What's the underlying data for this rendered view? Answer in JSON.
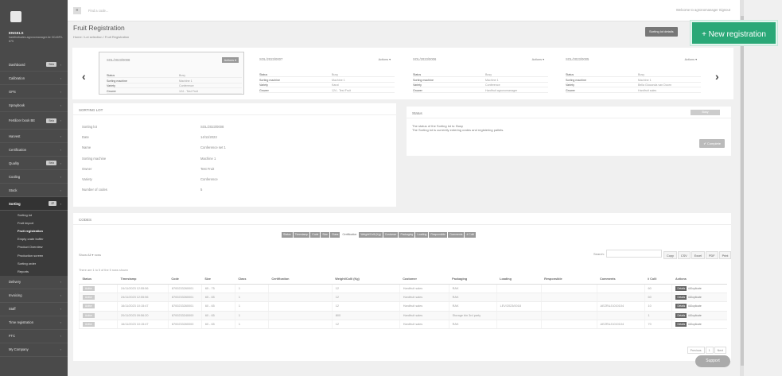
{
  "user": {
    "name": "ENGELS",
    "info": "hardfruitsales.agronomanager.be 0CA5F0-875"
  },
  "topbar": {
    "menu_icon": "hamburger-icon",
    "find": "Find a code...",
    "welcome": "Welcome to agronomanager  Signout"
  },
  "sidebar": {
    "items": [
      {
        "label": "Dashboard",
        "badge": "Beta"
      },
      {
        "label": "Calibration"
      },
      {
        "label": "GPS"
      },
      {
        "label": "Spraybook"
      },
      {
        "label": "Fertilizer book BE",
        "badge": "Beta"
      },
      {
        "label": "Harvest"
      },
      {
        "label": "Certification"
      },
      {
        "label": "Quality",
        "badge": "Beta"
      },
      {
        "label": "Cooling"
      },
      {
        "label": "Stock"
      },
      {
        "label": "Sorting",
        "badge": "27"
      },
      {
        "label": "Delivery"
      },
      {
        "label": "Invoicing"
      },
      {
        "label": "Staff"
      },
      {
        "label": "Time registration"
      },
      {
        "label": "FTC"
      },
      {
        "label": "My Company"
      }
    ],
    "subitems": [
      "Sorting lot",
      "Fruit import",
      "Fruit registration",
      "Empty crate buffer",
      "Product Overview",
      "Production screen",
      "Sorting order",
      "Reports"
    ]
  },
  "page": {
    "title": "Fruit Registration",
    "crumbs": "Home  /  Lot selection  /  Fruit Registration",
    "lot_details": "Sorting lot details",
    "new_registration": "+ New registration"
  },
  "cards": [
    {
      "id": "SOL/2023/0008",
      "actions": "Actions",
      "rows": [
        [
          "Status",
          "Busy"
        ],
        [
          "Sorting machine",
          "Machine 1"
        ],
        [
          "Variety",
          "Conference"
        ],
        [
          "Grower",
          "124 - Test Fruit"
        ]
      ]
    },
    {
      "id": "SOL/2023/0007",
      "actions": "Actions",
      "rows": [
        [
          "Status",
          "Busy"
        ],
        [
          "Sorting machine",
          "Machine 1"
        ],
        [
          "Variety",
          "Kanzi"
        ],
        [
          "Grower",
          "124 - Test Fruit"
        ]
      ]
    },
    {
      "id": "SOL/2023/0006",
      "actions": "Actions",
      "rows": [
        [
          "Status",
          "Busy"
        ],
        [
          "Sorting machine",
          "Machine 1"
        ],
        [
          "Variety",
          "Conference"
        ],
        [
          "Grower",
          "Hardfruit agronomanager"
        ]
      ]
    },
    {
      "id": "SOL/2023/0005",
      "actions": "Actions",
      "rows": [
        [
          "Status",
          "Busy"
        ],
        [
          "Sorting machine",
          "Machine 1"
        ],
        [
          "Variety",
          "Bella Gioconda van Doorn"
        ],
        [
          "Grower",
          "Hardfruit sales"
        ]
      ]
    }
  ],
  "lot": {
    "header": "SORTING LOT",
    "rows": [
      [
        "Sorting lot",
        "SOL/2023/0008"
      ],
      [
        "Date",
        "14/11/2023"
      ],
      [
        "Name",
        "Conference set 1"
      ],
      [
        "Sorting machine",
        "Machine 1"
      ],
      [
        "Owner",
        "Test Fruit"
      ],
      [
        "Variety",
        "Conference"
      ],
      [
        "Number of codes",
        "5"
      ]
    ]
  },
  "status": {
    "header": "Status",
    "label": "Busy",
    "line1": "The status of the Sorting lot is: Busy",
    "line2": "The Sorting lot is currently entering crates and registering pallets.",
    "complete": "✔ Complete"
  },
  "codes": {
    "header": "CODES",
    "colbuttons": [
      [
        "Status",
        true
      ],
      [
        "Timestamp",
        true
      ],
      [
        "Code",
        true
      ],
      [
        "Size",
        true
      ],
      [
        "Class",
        true
      ],
      [
        "Certification",
        false
      ],
      [
        "Weight/Colli (Kg)",
        true
      ],
      [
        "Customer",
        true
      ],
      [
        "Packaging",
        true
      ],
      [
        "Loading",
        true
      ],
      [
        "Responsible",
        true
      ],
      [
        "Comments",
        true
      ],
      [
        "# Colli",
        true
      ]
    ],
    "show": "Show  All  ▾  rows",
    "search": "Search:",
    "exports": [
      "Copy",
      "CSV",
      "Excel",
      "PDF",
      "Print"
    ],
    "entries": "There are 1 to 5 of the 5 rows shown",
    "headers": [
      "Status",
      "Timestamp",
      "Code",
      "Size",
      "Class",
      "Certification",
      "Weight/Colli (Kg)",
      "Customer",
      "Packaging",
      "Loading",
      "Responsible",
      "Comments",
      "# Colli",
      "Actions"
    ],
    "rows": [
      [
        "Active",
        "24/11/2023 12:55:56",
        "8700233260001",
        "65 - 75",
        "1",
        "",
        "12",
        "Hardfruit sales",
        "RAK",
        "",
        "",
        "",
        "60"
      ],
      [
        "Active",
        "24/11/2023 12:55:56",
        "8700233260001",
        "65 - 65",
        "1",
        "",
        "12",
        "Hardfruit sales",
        "RAK",
        "",
        "",
        "",
        "60"
      ],
      [
        "Active",
        "16/11/2023 10:15:47",
        "8700233260001",
        "60 - 65",
        "1",
        "",
        "12",
        "Hardfruit sales",
        "RAK",
        "LEV/2023/0018",
        "",
        "AEZRUJ1010104",
        "10"
      ],
      [
        "Active",
        "20/11/2023 09:56:20",
        "8700233240000",
        "60 - 65",
        "1",
        "",
        "800",
        "Hardfruit sales",
        "Storage bin 3rd party",
        "",
        "",
        "",
        "1"
      ],
      [
        "Active",
        "16/11/2023 10:15:47",
        "8700233260000",
        "60 - 65",
        "1",
        "",
        "12",
        "Hardfruit sales",
        "RAK",
        "",
        "",
        "AEZRUJ1010104",
        "70"
      ]
    ],
    "details": "Details",
    "duplicate": "Duplicate",
    "pager": [
      "Previous",
      "1",
      "Next"
    ]
  },
  "support": "Support"
}
